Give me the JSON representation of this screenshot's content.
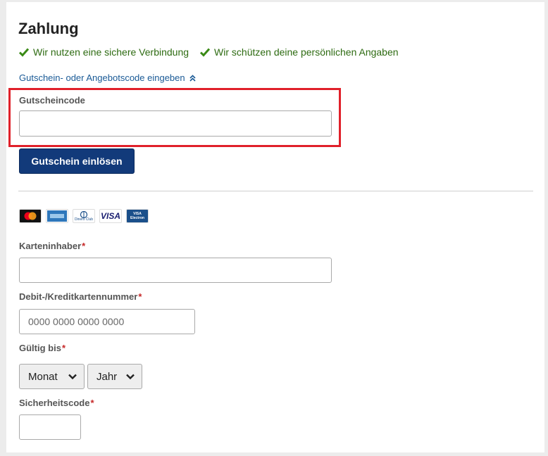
{
  "page": {
    "title": "Zahlung",
    "secure_badges": [
      "Wir nutzen eine sichere Verbindung",
      "Wir schützen deine persönlichen Angaben"
    ],
    "voucher_toggle": "Gutschein- oder Angebotscode eingeben"
  },
  "voucher": {
    "label": "Gutscheincode",
    "value": "",
    "placeholder": "",
    "button": "Gutschein einlösen"
  },
  "cards": [
    {
      "name": "mastercard-icon"
    },
    {
      "name": "amex-icon"
    },
    {
      "name": "diners-club-icon",
      "text": "Diners Club"
    },
    {
      "name": "visa-icon",
      "text": "VISA"
    },
    {
      "name": "visa-electron-icon",
      "text": "VISA Electron"
    }
  ],
  "form": {
    "holder_label": "Karteninhaber",
    "holder_value": "",
    "number_label": "Debit-/Kreditkartennummer",
    "number_placeholder": "0000 0000 0000 0000",
    "expiry_label": "Gültig bis",
    "month": "Monat",
    "year": "Jahr",
    "cvc_label": "Sicherheitscode",
    "cvc_value": "",
    "required_mark": "*"
  },
  "colors": {
    "button": "#123a7a",
    "link": "#1a5a96",
    "check": "#2e6b12",
    "highlight": "#e0202a",
    "required": "#c62828"
  }
}
